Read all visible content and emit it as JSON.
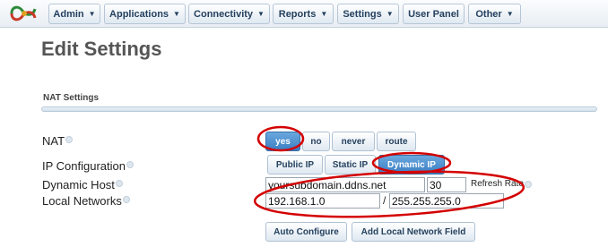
{
  "colors": {
    "annotation": "#d40000",
    "active_button": "#3b7ec2",
    "nav_text": "#24415f"
  },
  "nav": {
    "logo_icon": "celtic-knot-logo-icon",
    "items": [
      {
        "label": "Admin",
        "has_dropdown": true
      },
      {
        "label": "Applications",
        "has_dropdown": true
      },
      {
        "label": "Connectivity",
        "has_dropdown": true
      },
      {
        "label": "Reports",
        "has_dropdown": true
      },
      {
        "label": "Settings",
        "has_dropdown": true
      },
      {
        "label": "User Panel",
        "has_dropdown": false
      },
      {
        "label": "Other",
        "has_dropdown": true
      }
    ]
  },
  "page": {
    "title": "Edit Settings"
  },
  "nat_section": {
    "title": "NAT Settings",
    "nat": {
      "label": "NAT",
      "options": [
        "yes",
        "no",
        "never",
        "route"
      ],
      "selected": "yes"
    },
    "ip_config": {
      "label": "IP Configuration",
      "options": [
        "Public IP",
        "Static IP",
        "Dynamic IP"
      ],
      "selected": "Dynamic IP"
    },
    "dynamic_host": {
      "label": "Dynamic Host",
      "host": "yoursubdomain.ddns.net",
      "refresh": "30",
      "refresh_label": "Refresh Rate"
    },
    "local_networks": {
      "label": "Local Networks",
      "network": "192.168.1.0",
      "separator": "/",
      "netmask": "255.255.255.0"
    },
    "actions": {
      "auto_configure": "Auto Configure",
      "add_field": "Add Local Network Field"
    }
  }
}
